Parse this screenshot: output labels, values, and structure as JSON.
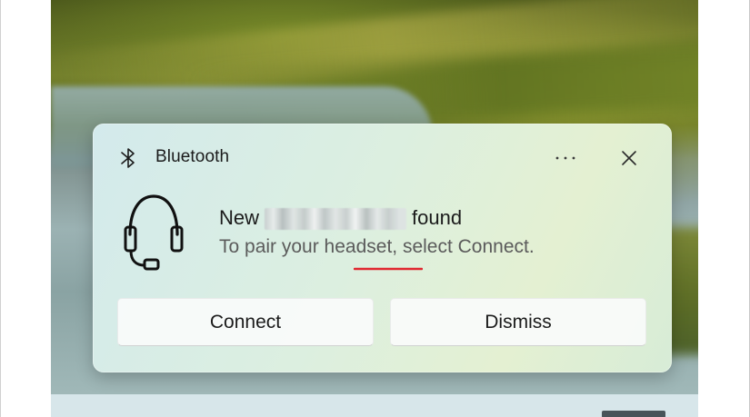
{
  "toast": {
    "app_name": "Bluetooth",
    "title_prefix": "New",
    "title_suffix": "found",
    "subtitle": "To pair your headset, select Connect.",
    "misspelled_word": "headset",
    "connect_label": "Connect",
    "dismiss_label": "Dismiss"
  },
  "icons": {
    "app": "bluetooth-icon",
    "more": "more-options-icon",
    "close": "close-icon",
    "device": "headset-icon"
  },
  "colors": {
    "spellcheck_underline": "#e0262f",
    "toast_bg_start": "#d3eaec",
    "toast_bg_end": "#e4f0d2",
    "text_primary": "#1b1b1b",
    "text_secondary": "#5b5b5b"
  }
}
